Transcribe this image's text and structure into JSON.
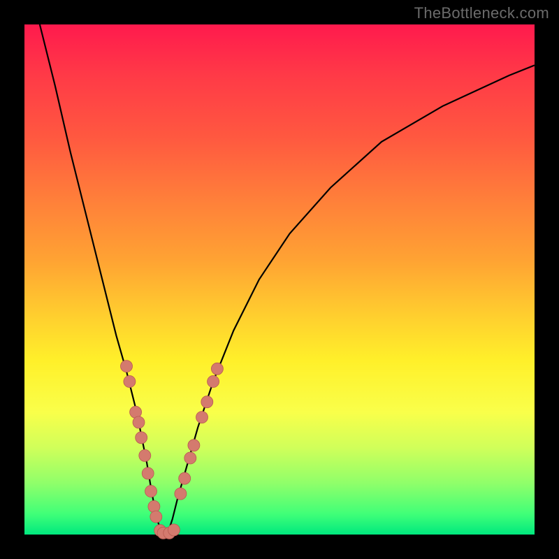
{
  "watermark": "TheBottleneck.com",
  "colors": {
    "gradient_top": "#ff1a4d",
    "gradient_mid": "#ffd22e",
    "gradient_bottom": "#00e87e",
    "curve": "#000000",
    "dot_fill": "#d47a6e",
    "dot_stroke": "#b85a50",
    "frame": "#000000"
  },
  "chart_data": {
    "type": "line",
    "title": "",
    "xlabel": "",
    "ylabel": "",
    "xlim": [
      0,
      100
    ],
    "ylim": [
      0,
      100
    ],
    "note": "V-shaped bottleneck curve over vertical rainbow gradient; minimum near x≈27. y-axis inverted visually (0 at bottom green, 100 at top red).",
    "series": [
      {
        "name": "bottleneck-curve",
        "x": [
          3,
          6,
          9,
          12,
          15,
          18,
          20,
          22,
          24,
          25,
          26,
          27,
          28,
          29,
          30,
          32,
          34,
          37,
          41,
          46,
          52,
          60,
          70,
          82,
          95,
          100
        ],
        "y": [
          100,
          88,
          75,
          63,
          51,
          39,
          32,
          24,
          14,
          8,
          3,
          0,
          0,
          3,
          7,
          14,
          21,
          30,
          40,
          50,
          59,
          68,
          77,
          84,
          90,
          92
        ]
      }
    ],
    "scatter": [
      {
        "name": "left-branch-dots",
        "x": [
          20.0,
          20.6,
          21.8,
          22.4,
          22.9,
          23.6,
          24.2,
          24.8,
          25.4,
          25.8
        ],
        "y": [
          33.0,
          30.0,
          24.0,
          22.0,
          19.0,
          15.5,
          12.0,
          8.5,
          5.5,
          3.5
        ]
      },
      {
        "name": "bottom-dots",
        "x": [
          26.6,
          27.2,
          28.4,
          29.3
        ],
        "y": [
          0.8,
          0.3,
          0.3,
          0.9
        ]
      },
      {
        "name": "right-branch-dots",
        "x": [
          30.6,
          31.4,
          32.5,
          33.2,
          34.8,
          35.8,
          37.0,
          37.8
        ],
        "y": [
          8.0,
          11.0,
          15.0,
          17.5,
          23.0,
          26.0,
          30.0,
          32.5
        ]
      }
    ]
  }
}
